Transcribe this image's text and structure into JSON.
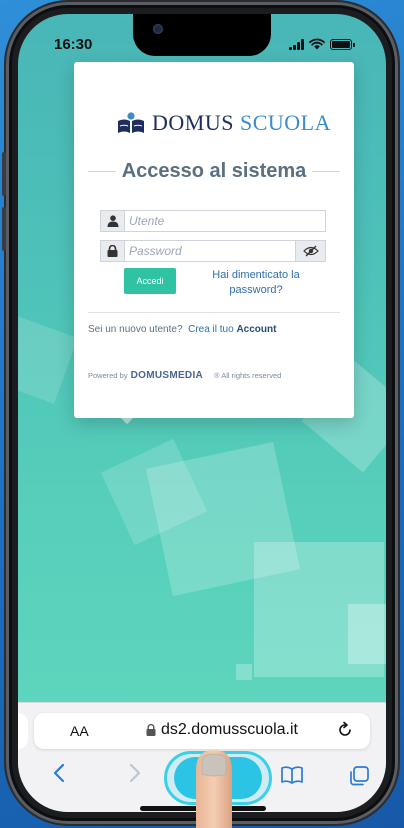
{
  "status_bar": {
    "time": "16:30"
  },
  "login": {
    "logo_part1": "DOMUS",
    "logo_part2": "SCUOLA",
    "title": "Accesso al sistema",
    "username_placeholder": "Utente",
    "password_placeholder": "Password",
    "submit_label": "Accedi",
    "forgot_line1": "Hai dimenticato la",
    "forgot_line2": "password?",
    "new_user_question": "Sei un nuovo utente?",
    "create_prefix": "Crea il tuo",
    "create_account": "Account",
    "powered_by": "Powered by",
    "powered_brand": "DOMUSMEDIA",
    "rights": "® All rights reserved"
  },
  "browser": {
    "text_size_label": "AA",
    "url": "ds2.domusscuola.it"
  },
  "colors": {
    "accent_button": "#2fc2a3",
    "link": "#2f6fb0",
    "share_highlight": "#2cc4e4",
    "background_top": "#49b6b7",
    "background_bottom": "#62d9bf"
  },
  "icons": {
    "user": "user-icon",
    "lock": "lock-icon",
    "eye": "eye-slash-icon",
    "share": "share-icon",
    "bookmarks": "book-icon",
    "tabs": "tabs-icon"
  }
}
